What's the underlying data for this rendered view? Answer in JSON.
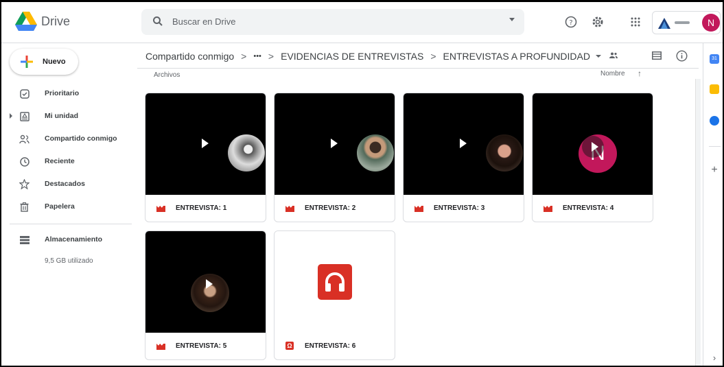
{
  "app": {
    "brand": "Drive"
  },
  "search": {
    "placeholder": "Buscar en Drive"
  },
  "account": {
    "initial": "N"
  },
  "sidebar": {
    "new_label": "Nuevo",
    "items": [
      {
        "label": "Prioritario",
        "icon": "check-circle-icon"
      },
      {
        "label": "Mi unidad",
        "icon": "my-drive-icon"
      },
      {
        "label": "Compartido conmigo",
        "icon": "shared-people-icon"
      },
      {
        "label": "Reciente",
        "icon": "clock-icon"
      },
      {
        "label": "Destacados",
        "icon": "star-icon"
      },
      {
        "label": "Papelera",
        "icon": "trash-icon"
      }
    ],
    "storage": {
      "label": "Almacenamiento",
      "used": "9,5 GB utilizado"
    }
  },
  "breadcrumb": {
    "items": [
      "Compartido conmigo",
      "•••",
      "EVIDENCIAS DE ENTREVISTAS",
      "ENTREVISTAS A PROFUNDIDAD"
    ],
    "separator": ">"
  },
  "files": {
    "section_label": "Archivos",
    "sort_label": "Nombre",
    "items": [
      {
        "name": "ENTREVISTA: 1",
        "type": "video"
      },
      {
        "name": "ENTREVISTA: 2",
        "type": "video"
      },
      {
        "name": "ENTREVISTA: 3",
        "type": "video"
      },
      {
        "name": "ENTREVISTA: 4",
        "type": "video"
      },
      {
        "name": "ENTREVISTA: 5",
        "type": "video"
      },
      {
        "name": "ENTREVISTA: 6",
        "type": "audio"
      }
    ]
  },
  "colors": {
    "accent": "#d93025",
    "avatar": "#c2185b",
    "text": "#202124",
    "muted": "#5f6368"
  }
}
